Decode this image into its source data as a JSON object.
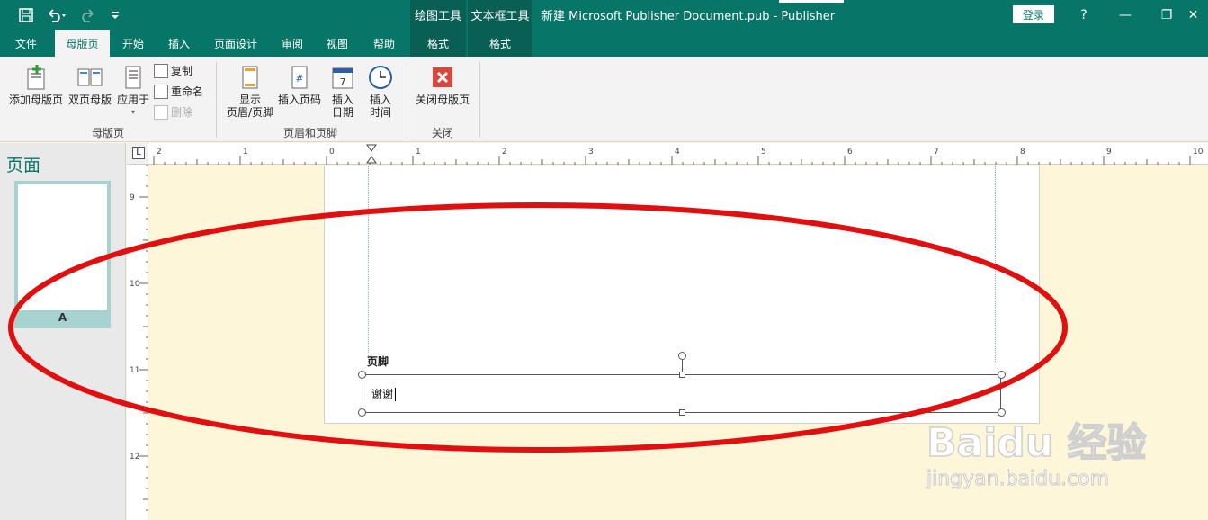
{
  "titlebar": {
    "tool_tabs": [
      "绘图工具",
      "文本框工具"
    ],
    "doc_title": "新建 Microsoft Publisher Document.pub  -  Publisher",
    "login": "登录",
    "help": "?",
    "minimize": "—",
    "restore": "❐",
    "close": "✕"
  },
  "ribbon_tabs": [
    "文件",
    "母版页",
    "开始",
    "插入",
    "页面设计",
    "审阅",
    "视图",
    "帮助",
    "格式",
    "格式"
  ],
  "ribbon": {
    "master_group": {
      "add_master": "添加母版页",
      "two_page_master": "双页母版",
      "apply_to": "应用于",
      "copy": "复制",
      "rename": "重命名",
      "delete": "删除",
      "label": "母版页"
    },
    "header_footer_group": {
      "show_header_footer_1": "显示",
      "show_header_footer_2": "页眉/页脚",
      "insert_page_number": "插入页码",
      "insert_date_1": "插入",
      "insert_date_2": "日期",
      "insert_time_1": "插入",
      "insert_time_2": "时间",
      "label": "页眉和页脚"
    },
    "close_group": {
      "close_master": "关闭母版页",
      "label": "关闭"
    }
  },
  "pages_panel": {
    "title": "页面",
    "thumbnail_label": "A"
  },
  "ruler": {
    "corner": "L",
    "h_numbers": [
      "2",
      "1",
      "0",
      "1",
      "2",
      "3",
      "4",
      "5",
      "6",
      "7",
      "8",
      "9",
      "10"
    ],
    "v_numbers": [
      "9",
      "10",
      "11",
      "12"
    ]
  },
  "canvas": {
    "footer_label": "页脚",
    "textbox_text": "谢谢"
  },
  "watermark": {
    "main": "Baidu 经验",
    "sub": "jingyan.baidu.com"
  },
  "colors": {
    "accent": "#077568",
    "annotation": "#e01010"
  }
}
